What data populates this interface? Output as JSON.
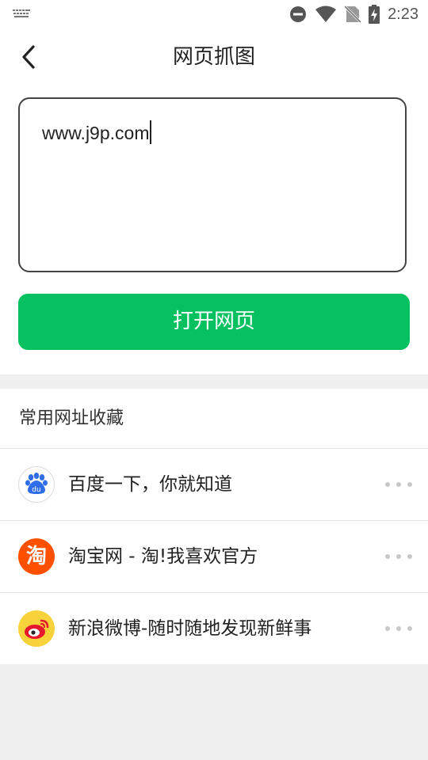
{
  "status_bar": {
    "time": "2:23",
    "icons": [
      "keyboard-icon",
      "do-not-disturb-icon",
      "wifi-icon",
      "no-sim-icon",
      "battery-charging-icon"
    ]
  },
  "header": {
    "back_icon": "chevron-left-icon",
    "title": "网页抓图"
  },
  "url_input": {
    "value": "www.j9p.com"
  },
  "open_button": {
    "label": "打开网页",
    "color": "#07c160"
  },
  "favorites": {
    "title": "常用网址收藏",
    "items": [
      {
        "label": "百度一下，你就知道",
        "icon": "baidu-paw-icon"
      },
      {
        "label": "淘宝网 - 淘!我喜欢官方",
        "icon": "taobao-icon",
        "icon_text": "淘"
      },
      {
        "label": "新浪微博-随时随地发现新鲜事",
        "icon": "weibo-icon"
      }
    ],
    "more_icon": "more-dots-icon"
  }
}
